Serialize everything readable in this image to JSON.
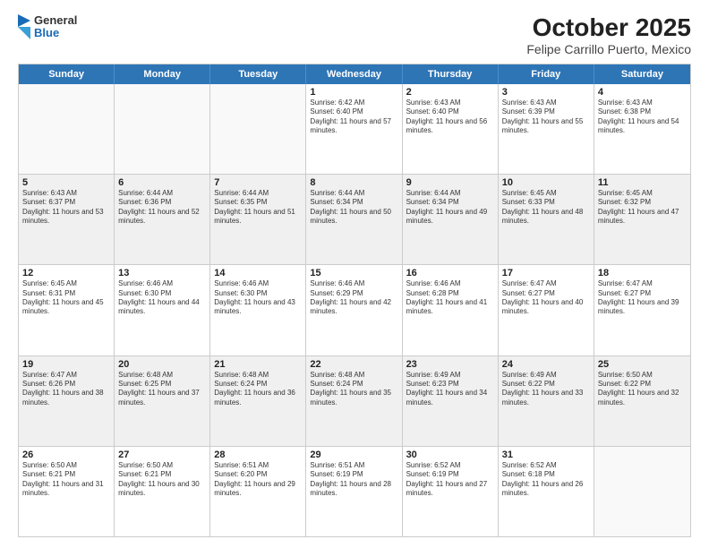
{
  "logo": {
    "general": "General",
    "blue": "Blue"
  },
  "title": "October 2025",
  "subtitle": "Felipe Carrillo Puerto, Mexico",
  "days": [
    "Sunday",
    "Monday",
    "Tuesday",
    "Wednesday",
    "Thursday",
    "Friday",
    "Saturday"
  ],
  "weeks": [
    {
      "shaded": false,
      "cells": [
        {
          "day": "",
          "text": ""
        },
        {
          "day": "",
          "text": ""
        },
        {
          "day": "",
          "text": ""
        },
        {
          "day": "1",
          "text": "Sunrise: 6:42 AM\nSunset: 6:40 PM\nDaylight: 11 hours and 57 minutes."
        },
        {
          "day": "2",
          "text": "Sunrise: 6:43 AM\nSunset: 6:40 PM\nDaylight: 11 hours and 56 minutes."
        },
        {
          "day": "3",
          "text": "Sunrise: 6:43 AM\nSunset: 6:39 PM\nDaylight: 11 hours and 55 minutes."
        },
        {
          "day": "4",
          "text": "Sunrise: 6:43 AM\nSunset: 6:38 PM\nDaylight: 11 hours and 54 minutes."
        }
      ]
    },
    {
      "shaded": true,
      "cells": [
        {
          "day": "5",
          "text": "Sunrise: 6:43 AM\nSunset: 6:37 PM\nDaylight: 11 hours and 53 minutes."
        },
        {
          "day": "6",
          "text": "Sunrise: 6:44 AM\nSunset: 6:36 PM\nDaylight: 11 hours and 52 minutes."
        },
        {
          "day": "7",
          "text": "Sunrise: 6:44 AM\nSunset: 6:35 PM\nDaylight: 11 hours and 51 minutes."
        },
        {
          "day": "8",
          "text": "Sunrise: 6:44 AM\nSunset: 6:34 PM\nDaylight: 11 hours and 50 minutes."
        },
        {
          "day": "9",
          "text": "Sunrise: 6:44 AM\nSunset: 6:34 PM\nDaylight: 11 hours and 49 minutes."
        },
        {
          "day": "10",
          "text": "Sunrise: 6:45 AM\nSunset: 6:33 PM\nDaylight: 11 hours and 48 minutes."
        },
        {
          "day": "11",
          "text": "Sunrise: 6:45 AM\nSunset: 6:32 PM\nDaylight: 11 hours and 47 minutes."
        }
      ]
    },
    {
      "shaded": false,
      "cells": [
        {
          "day": "12",
          "text": "Sunrise: 6:45 AM\nSunset: 6:31 PM\nDaylight: 11 hours and 45 minutes."
        },
        {
          "day": "13",
          "text": "Sunrise: 6:46 AM\nSunset: 6:30 PM\nDaylight: 11 hours and 44 minutes."
        },
        {
          "day": "14",
          "text": "Sunrise: 6:46 AM\nSunset: 6:30 PM\nDaylight: 11 hours and 43 minutes."
        },
        {
          "day": "15",
          "text": "Sunrise: 6:46 AM\nSunset: 6:29 PM\nDaylight: 11 hours and 42 minutes."
        },
        {
          "day": "16",
          "text": "Sunrise: 6:46 AM\nSunset: 6:28 PM\nDaylight: 11 hours and 41 minutes."
        },
        {
          "day": "17",
          "text": "Sunrise: 6:47 AM\nSunset: 6:27 PM\nDaylight: 11 hours and 40 minutes."
        },
        {
          "day": "18",
          "text": "Sunrise: 6:47 AM\nSunset: 6:27 PM\nDaylight: 11 hours and 39 minutes."
        }
      ]
    },
    {
      "shaded": true,
      "cells": [
        {
          "day": "19",
          "text": "Sunrise: 6:47 AM\nSunset: 6:26 PM\nDaylight: 11 hours and 38 minutes."
        },
        {
          "day": "20",
          "text": "Sunrise: 6:48 AM\nSunset: 6:25 PM\nDaylight: 11 hours and 37 minutes."
        },
        {
          "day": "21",
          "text": "Sunrise: 6:48 AM\nSunset: 6:24 PM\nDaylight: 11 hours and 36 minutes."
        },
        {
          "day": "22",
          "text": "Sunrise: 6:48 AM\nSunset: 6:24 PM\nDaylight: 11 hours and 35 minutes."
        },
        {
          "day": "23",
          "text": "Sunrise: 6:49 AM\nSunset: 6:23 PM\nDaylight: 11 hours and 34 minutes."
        },
        {
          "day": "24",
          "text": "Sunrise: 6:49 AM\nSunset: 6:22 PM\nDaylight: 11 hours and 33 minutes."
        },
        {
          "day": "25",
          "text": "Sunrise: 6:50 AM\nSunset: 6:22 PM\nDaylight: 11 hours and 32 minutes."
        }
      ]
    },
    {
      "shaded": false,
      "cells": [
        {
          "day": "26",
          "text": "Sunrise: 6:50 AM\nSunset: 6:21 PM\nDaylight: 11 hours and 31 minutes."
        },
        {
          "day": "27",
          "text": "Sunrise: 6:50 AM\nSunset: 6:21 PM\nDaylight: 11 hours and 30 minutes."
        },
        {
          "day": "28",
          "text": "Sunrise: 6:51 AM\nSunset: 6:20 PM\nDaylight: 11 hours and 29 minutes."
        },
        {
          "day": "29",
          "text": "Sunrise: 6:51 AM\nSunset: 6:19 PM\nDaylight: 11 hours and 28 minutes."
        },
        {
          "day": "30",
          "text": "Sunrise: 6:52 AM\nSunset: 6:19 PM\nDaylight: 11 hours and 27 minutes."
        },
        {
          "day": "31",
          "text": "Sunrise: 6:52 AM\nSunset: 6:18 PM\nDaylight: 11 hours and 26 minutes."
        },
        {
          "day": "",
          "text": ""
        }
      ]
    }
  ]
}
